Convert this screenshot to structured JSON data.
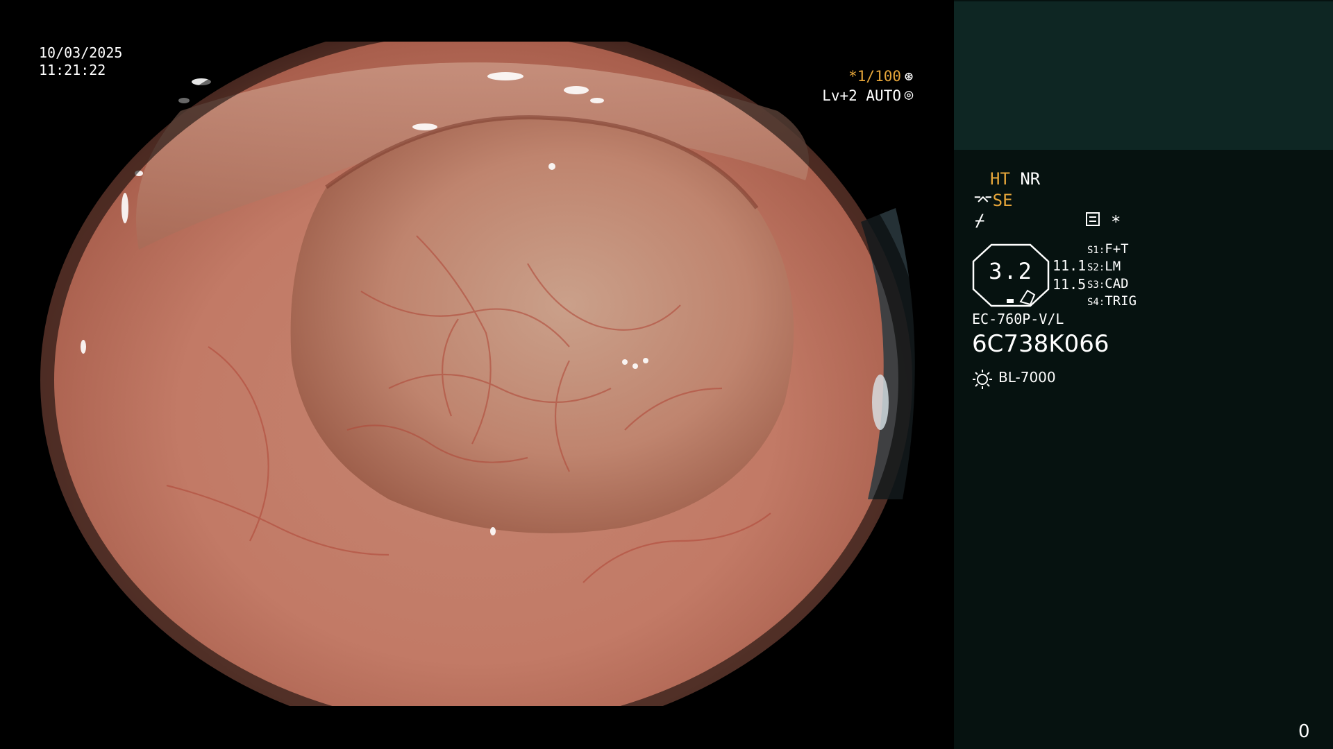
{
  "overlay": {
    "date": "10/03/2025",
    "time": "11:21:22",
    "shutter": "*1/100",
    "level": "Lv+2 AUTO"
  },
  "info": {
    "ht": "HT",
    "nr": "NR",
    "se": "SE",
    "asterisk": "*",
    "octagon_value": "3.2",
    "num1": "11.1",
    "num2": "11.5",
    "settings": [
      {
        "label": "S1:",
        "value": "F+T"
      },
      {
        "label": "S2:",
        "value": "LM"
      },
      {
        "label": "S3:",
        "value": "CAD"
      },
      {
        "label": "S4:",
        "value": "TRIG"
      }
    ],
    "model": "EC-760P-V/L",
    "serial": "6C738K066",
    "light": "BL-7000",
    "corner": "0"
  },
  "colors": {
    "accent_orange": "#e6a63a",
    "panel_dark": "#061210",
    "panel_top": "#0e2623"
  }
}
